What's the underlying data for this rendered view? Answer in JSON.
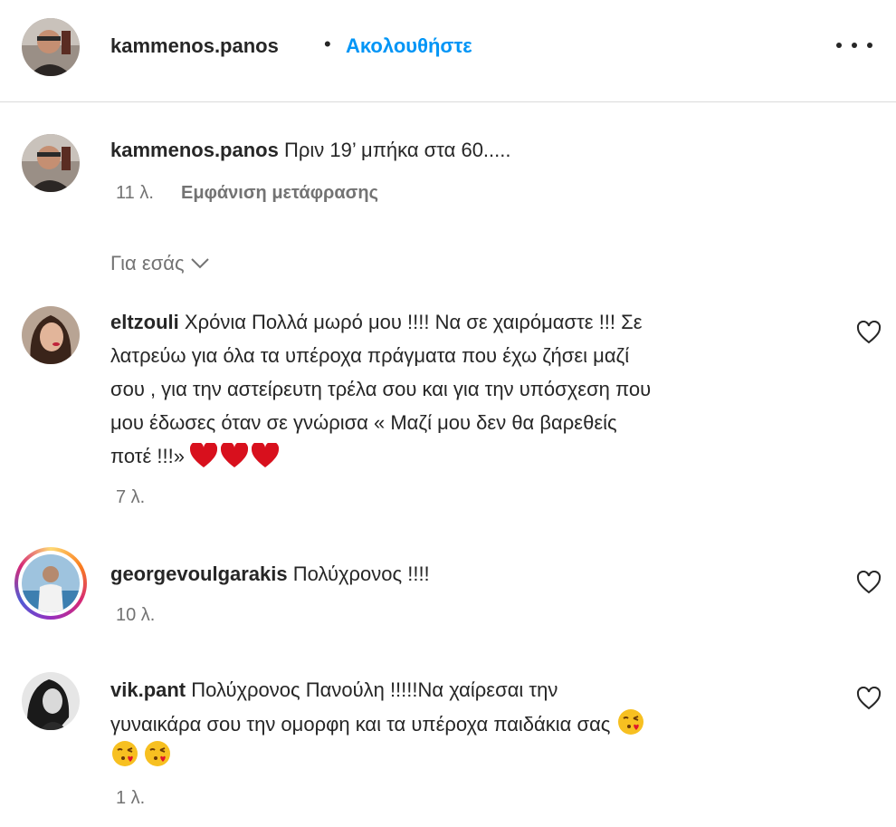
{
  "header": {
    "username": "kammenos.panos",
    "separator": "•",
    "follow_label": "Ακολουθήστε",
    "more_icon": "more-horizontal-icon"
  },
  "caption": {
    "username": "kammenos.panos",
    "text": "Πριν 19’ μπήκα στα 60.....",
    "time": "11 λ.",
    "translation_label": "Εμφάνιση μετάφρασης"
  },
  "for_you": {
    "label": "Για εσάς",
    "icon": "chevron-down-icon"
  },
  "comments": [
    {
      "username": "eltzouli",
      "lines": [
        "Χρόνια Πολλά μωρό μου !!!! Να σε χαιρόμαστε !!! Σε",
        "λατρεύω για όλα τα υπέροχα πράγματα που έχω ζήσει μαζί",
        "σου , για την αστείρευτη τρέλα σου και για την υπόσχεση που",
        "μου έδωσες όταν σε γνώρισα « Μαζί μου δεν θα βαρεθείς",
        "ποτέ !!!»"
      ],
      "emojis": [
        "red-heart",
        "red-heart",
        "red-heart"
      ],
      "time": "7 λ."
    },
    {
      "username": "georgevoulgarakis",
      "lines": [
        "Πολύχρονος !!!!"
      ],
      "time": "10 λ."
    },
    {
      "username": "vik.pant",
      "lines": [
        "Πολύχρονος Πανούλη !!!!!Να χαίρεσαι την",
        "γυναικάρα σου την ομορφη και τα υπέροχα παιδάκια σας"
      ],
      "emojis": [
        "face-blowing-kiss",
        "face-blowing-kiss",
        "face-blowing-kiss"
      ],
      "time": "1 λ."
    }
  ],
  "colors": {
    "link": "#0095f6",
    "secondary_text": "#737373",
    "story_ring": "#d62976"
  }
}
